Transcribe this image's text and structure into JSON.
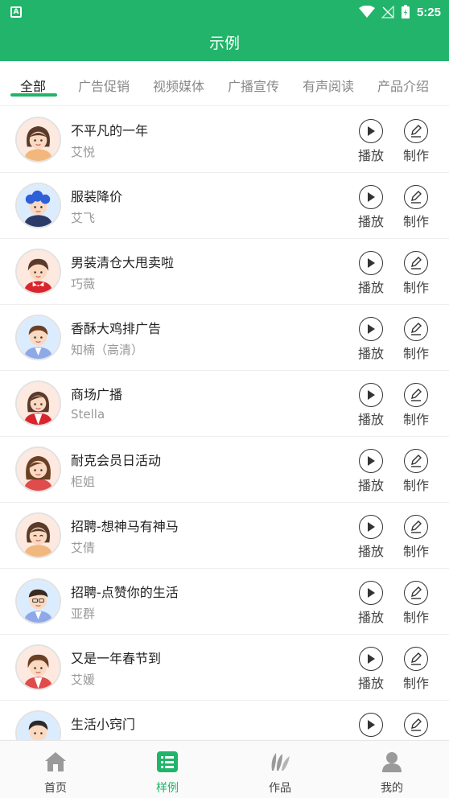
{
  "status_bar": {
    "time": "5:25"
  },
  "header": {
    "title": "示例"
  },
  "tabs": [
    {
      "label": "全部"
    },
    {
      "label": "广告促销"
    },
    {
      "label": "视频媒体"
    },
    {
      "label": "广播宣传"
    },
    {
      "label": "有声阅读"
    },
    {
      "label": "产品介绍"
    }
  ],
  "actions": {
    "play_label": "播放",
    "make_label": "制作"
  },
  "items": [
    {
      "title": "不平凡的一年",
      "voice": "艾悦"
    },
    {
      "title": "服装降价",
      "voice": "艾飞"
    },
    {
      "title": "男装清仓大甩卖啦",
      "voice": "巧薇"
    },
    {
      "title": "香酥大鸡排广告",
      "voice": "知楠（高清）"
    },
    {
      "title": "商场广播",
      "voice": "Stella"
    },
    {
      "title": "耐克会员日活动",
      "voice": "柜姐"
    },
    {
      "title": "招聘-想神马有神马",
      "voice": "艾倩"
    },
    {
      "title": "招聘-点赞你的生活",
      "voice": "亚群"
    },
    {
      "title": "又是一年春节到",
      "voice": "艾媛"
    },
    {
      "title": "生活小窍门",
      "voice": ""
    }
  ],
  "bottom_nav": [
    {
      "label": "首页",
      "icon": "home-icon"
    },
    {
      "label": "样例",
      "icon": "list-icon"
    },
    {
      "label": "作品",
      "icon": "works-icon"
    },
    {
      "label": "我的",
      "icon": "user-icon"
    }
  ],
  "colors": {
    "brand": "#21b46a"
  }
}
